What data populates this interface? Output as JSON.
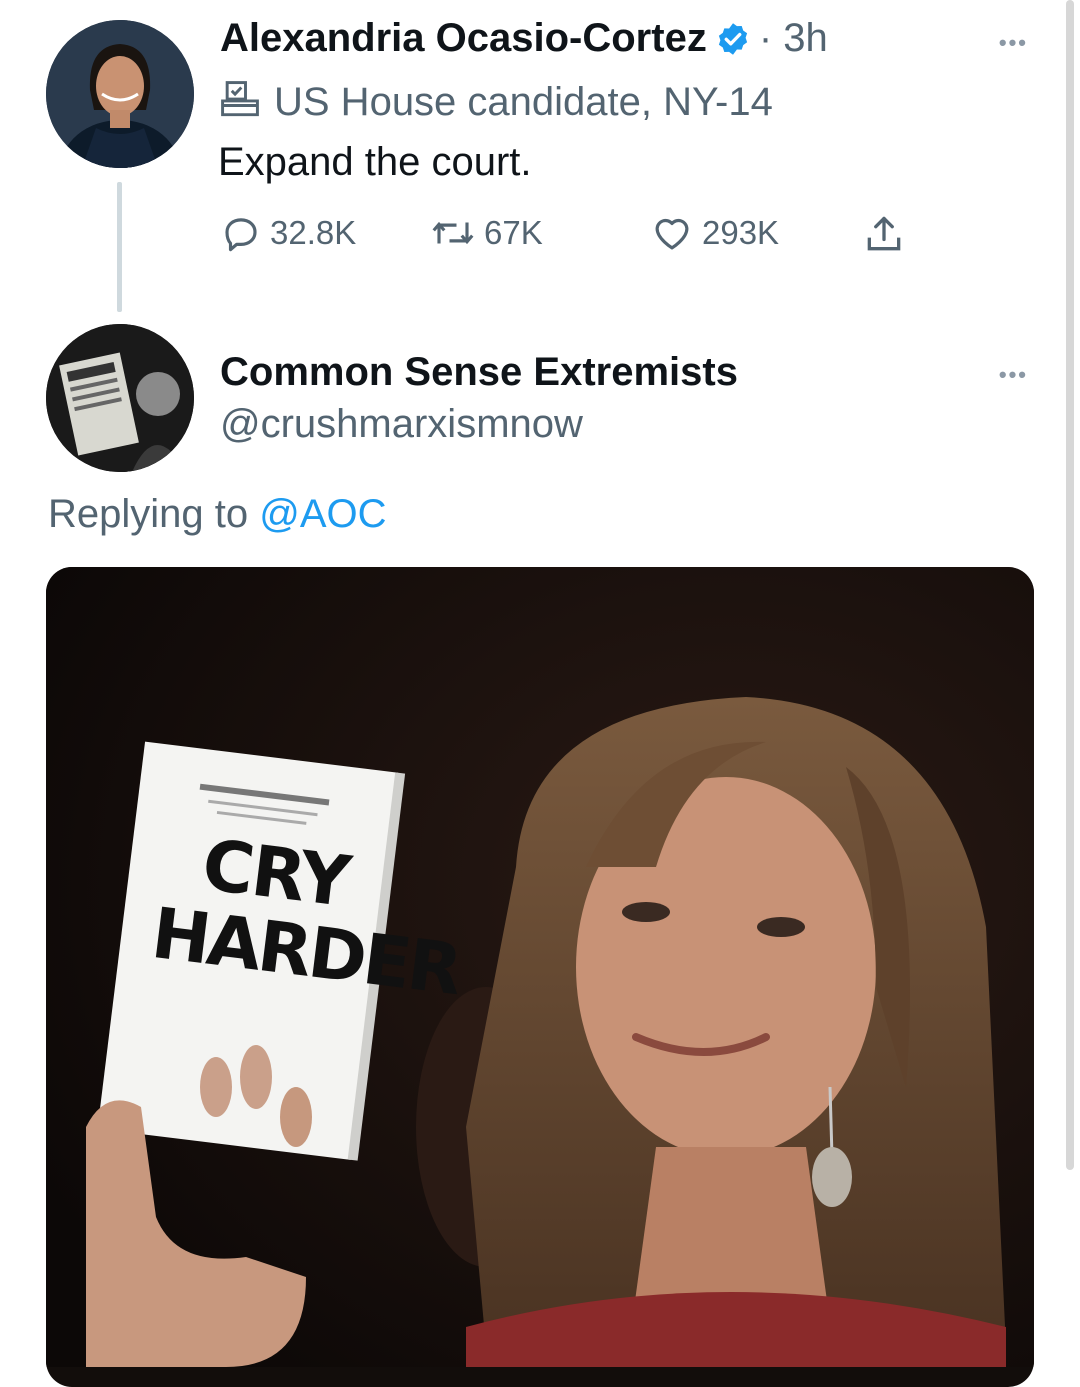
{
  "tweet": {
    "author_name": "Alexandria Ocasio-Cortez",
    "time": "· 3h",
    "label": "US House candidate, NY-14",
    "text": "Expand the court.",
    "stats": {
      "replies": "32.8K",
      "retweets": "67K",
      "likes": "293K"
    },
    "more": "•••"
  },
  "reply": {
    "author_name": "Common Sense Extremists",
    "handle": "@crushmarxismnow",
    "replying_prefix": "Replying to",
    "replying_to": "@AOC",
    "more": "•••",
    "image_text_line1": "CRY",
    "image_text_line2": "HARDER"
  },
  "colors": {
    "accent": "#1d9bf0",
    "muted": "#536471",
    "verified": "#1d9bf0"
  },
  "icons": [
    "reply-icon",
    "retweet-icon",
    "like-icon",
    "share-icon",
    "ballot-box-icon",
    "verified-badge-icon",
    "more-icon"
  ]
}
